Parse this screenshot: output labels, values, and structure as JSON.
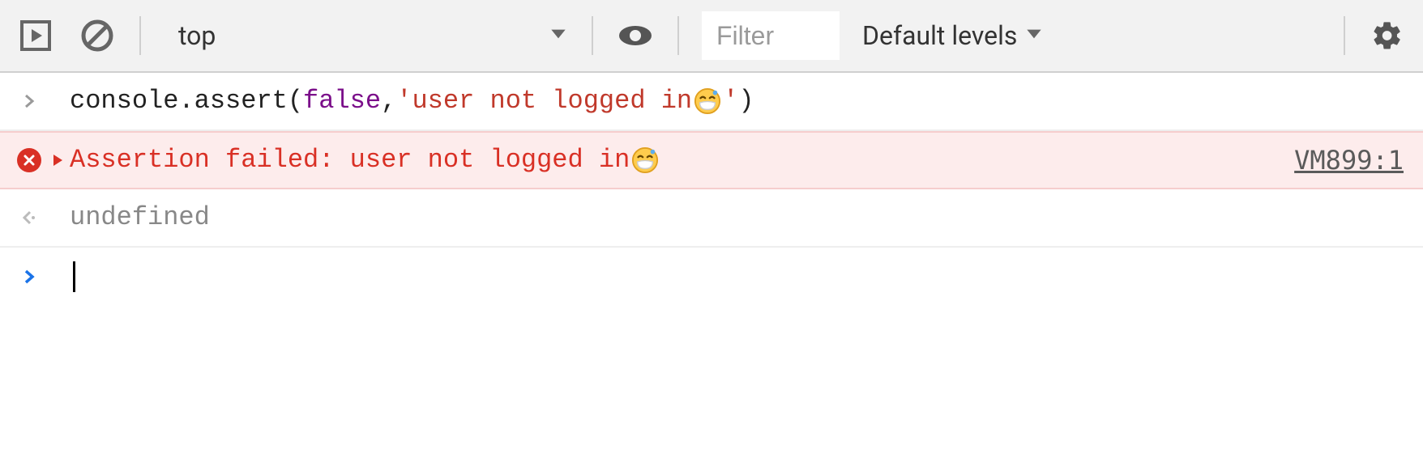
{
  "toolbar": {
    "context": "top",
    "filter_placeholder": "Filter",
    "levels_label": "Default levels"
  },
  "rows": {
    "input": {
      "seg1": "console",
      "seg2": ".assert(",
      "seg3": "false",
      "seg4": ", ",
      "seg5": "'user not logged in ",
      "seg6": "'",
      "seg7": ")"
    },
    "error": {
      "message": "Assertion failed: user not logged in ",
      "source": "VM899:1"
    },
    "return": {
      "value": "undefined"
    }
  }
}
